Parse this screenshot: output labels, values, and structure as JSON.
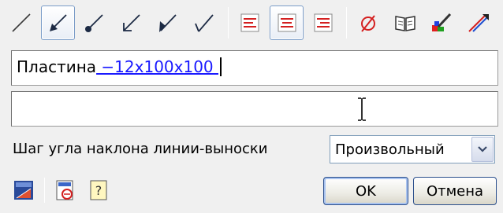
{
  "toolbar": {
    "tools": [
      {
        "icon": "line-plain-icon"
      },
      {
        "icon": "line-arrow-icon",
        "active": true
      },
      {
        "icon": "line-dot-icon"
      },
      {
        "icon": "line-open-arrow-icon"
      },
      {
        "icon": "line-half-arrow-icon"
      },
      {
        "icon": "line-tick-icon"
      },
      {
        "icon": "align-left-icon"
      },
      {
        "icon": "align-center-icon",
        "active": true
      },
      {
        "icon": "align-right-icon"
      },
      {
        "icon": "diameter-icon"
      },
      {
        "icon": "book-icon"
      },
      {
        "icon": "brush-icon"
      },
      {
        "icon": "pen-icon"
      }
    ]
  },
  "text_field_1": {
    "prefix": "Пластина",
    "value": " −12x100x100 "
  },
  "text_field_2": {
    "value": ""
  },
  "angle_step": {
    "label": "Шаг угла наклона линии-выноски",
    "selected": "Произвольный"
  },
  "bottom_tools": [
    {
      "icon": "properties-icon"
    },
    {
      "icon": "gost-stamp-icon"
    },
    {
      "icon": "help-icon"
    }
  ],
  "buttons": {
    "ok": "OK",
    "cancel": "Отмена"
  },
  "colors": {
    "accent_blue": "#1a1aff",
    "align_red": "#d42020",
    "button_border": "#2b4f8c"
  }
}
